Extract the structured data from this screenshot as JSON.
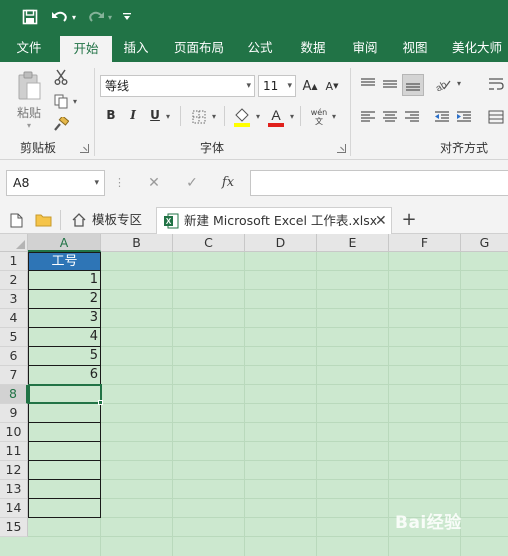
{
  "quick_access": {
    "save_icon": "save-icon",
    "undo_icon": "undo-icon",
    "redo_icon": "redo-icon",
    "customize_icon": "customize-icon"
  },
  "ribbon_tabs": [
    "文件",
    "开始",
    "插入",
    "页面布局",
    "公式",
    "数据",
    "审阅",
    "视图",
    "美化大师"
  ],
  "active_tab": "开始",
  "clipboard": {
    "paste_label": "粘贴",
    "group_label": "剪贴板"
  },
  "font": {
    "name": "等线",
    "size": "11",
    "group_label": "字体",
    "bold": "B",
    "italic": "I",
    "underline": "U",
    "phonetic": "wén\n文"
  },
  "alignment": {
    "group_label": "对齐方式"
  },
  "formula_bar": {
    "name_box": "A8",
    "fx": "fx",
    "formula": ""
  },
  "doc_tabs": {
    "template_tab": "模板专区",
    "file_tab": "新建 Microsoft Excel 工作表.xlsx",
    "add": "+"
  },
  "sheet": {
    "columns": [
      "A",
      "B",
      "C",
      "D",
      "E",
      "F",
      "G"
    ],
    "rows": [
      "1",
      "2",
      "3",
      "4",
      "5",
      "6",
      "7",
      "8",
      "9",
      "10",
      "11",
      "12",
      "13",
      "14",
      "15"
    ],
    "header_cell": "工号",
    "values": [
      "1",
      "2",
      "3",
      "4",
      "5",
      "6"
    ],
    "active_cell": "A8"
  },
  "watermark": "Bai经验",
  "colors": {
    "excel_green": "#217346",
    "header_fill": "#2e75b6",
    "eye_protect_bg": "#cce8cf"
  }
}
